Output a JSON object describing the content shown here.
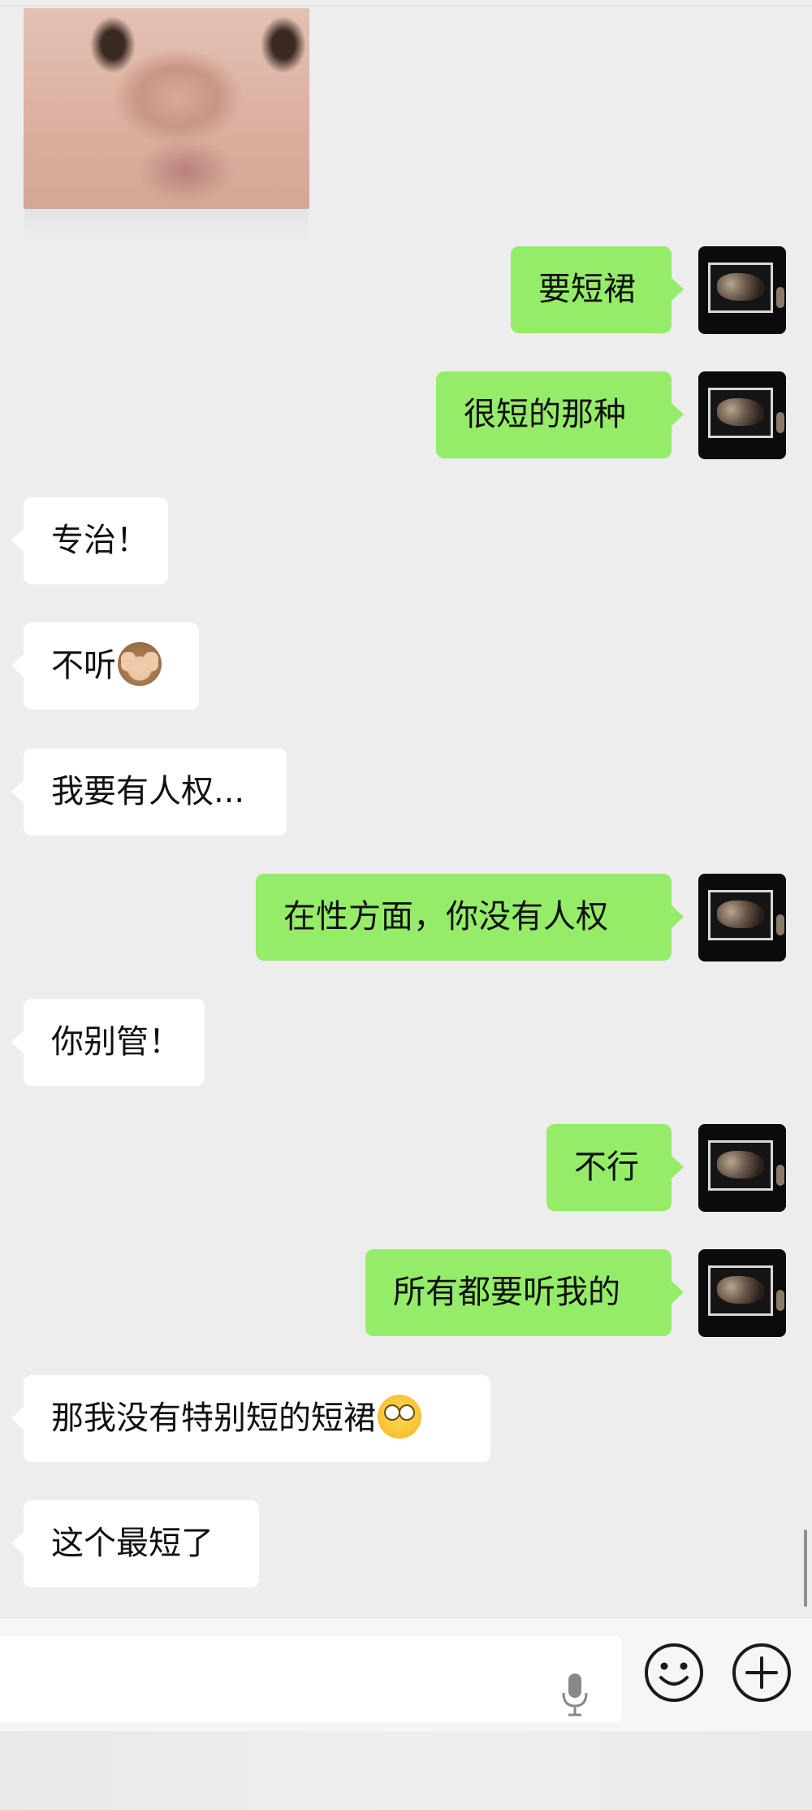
{
  "messages": [
    {
      "side": "me",
      "text": "要短裙"
    },
    {
      "side": "me",
      "text": "很短的那种"
    },
    {
      "side": "them",
      "text": "专治！"
    },
    {
      "side": "them",
      "text": "不听",
      "emoji": "hear-no-evil-monkey"
    },
    {
      "side": "them",
      "text": "我要有人权..."
    },
    {
      "side": "me",
      "text": "在性方面，你没有人权"
    },
    {
      "side": "them",
      "text": "你别管！"
    },
    {
      "side": "me",
      "text": "不行"
    },
    {
      "side": "me",
      "text": "所有都要听我的"
    },
    {
      "side": "them",
      "text": "那我没有特别短的短裙",
      "emoji": "face-with-rolling-eyes"
    },
    {
      "side": "them",
      "text": "这个最短了"
    }
  ],
  "icons": {
    "mic": "microphone-icon",
    "emoji": "smiley-face-icon",
    "plus": "plus-circle-icon"
  },
  "colors": {
    "background": "#ededed",
    "my_bubble": "#95ec69",
    "their_bubble": "#ffffff",
    "input_bar": "#f6f6f6"
  }
}
